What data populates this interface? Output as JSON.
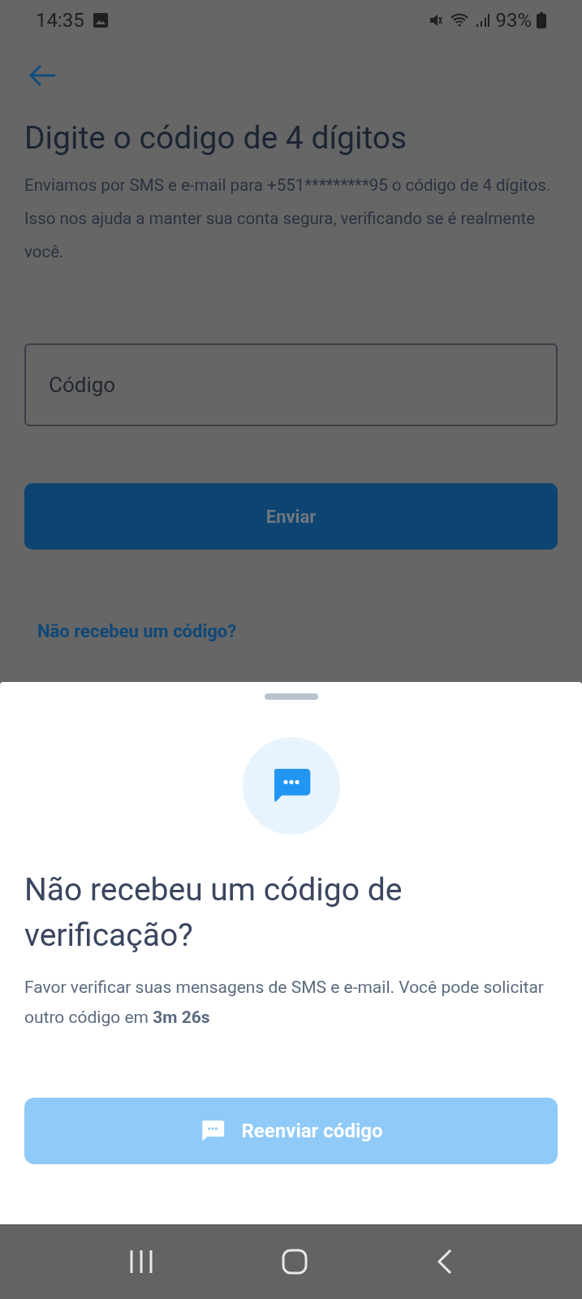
{
  "status_bar": {
    "time": "14:35",
    "battery": "93%"
  },
  "page": {
    "title": "Digite o código de 4 dígitos",
    "description": "Enviamos por SMS e e-mail para +551*********95 o código de 4 dígitos. Isso nos ajuda a manter sua conta segura, verificando se é realmente você.",
    "code_field": {
      "placeholder": "Código"
    },
    "submit_button": {
      "label": "Enviar",
      "disabled": true
    },
    "help_link": "Não recebeu um código?"
  },
  "sheet": {
    "title": "Não recebeu um código de verificação?",
    "message": "Favor verificar suas mensagens de SMS e e-mail. Você pode solicitar outro código em **3m 26s**",
    "resend_button": {
      "label": "Reenviar código",
      "disabled": true
    }
  }
}
